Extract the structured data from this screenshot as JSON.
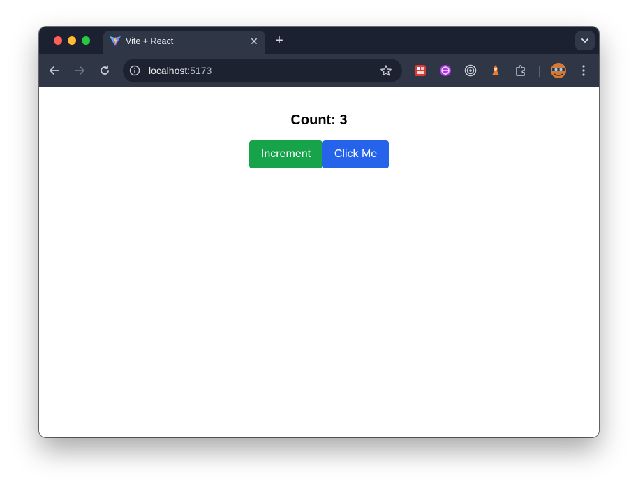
{
  "browser": {
    "tab_title": "Vite + React",
    "tab_close_icon": "close-icon",
    "new_tab_label": "+",
    "url_host": "localhost",
    "url_port": ":5173"
  },
  "page": {
    "count_text": "Count: 3",
    "increment_label": "Increment",
    "click_me_label": "Click Me"
  },
  "colors": {
    "increment_button": "#16a34a",
    "click_me_button": "#2563eb",
    "toolbar": "#2f3747",
    "titlebar": "#1b2130"
  },
  "icons": {
    "favicon": "vite-logo-icon",
    "back": "arrow-left-icon",
    "forward": "arrow-right-icon",
    "reload": "reload-icon",
    "site_info": "info-icon",
    "bookmark": "star-icon",
    "extensions": [
      "ext-red-icon",
      "ext-purple-icon",
      "ext-target-icon",
      "ext-orange-icon",
      "puzzle-icon"
    ],
    "menu": "kebab-menu-icon"
  }
}
